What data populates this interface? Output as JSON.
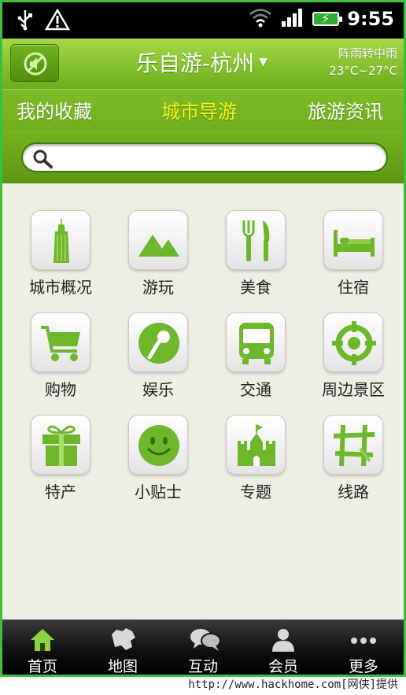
{
  "status_bar": {
    "time": "9:55"
  },
  "header": {
    "title": "乐自游-杭州",
    "weather_desc": "阵雨转中雨",
    "weather_temp": "23°C~27°C"
  },
  "tabs": [
    {
      "label": "我的收藏"
    },
    {
      "label": "城市导游",
      "active": true
    },
    {
      "label": "旅游资讯"
    }
  ],
  "search": {
    "value": "",
    "placeholder": ""
  },
  "grid": [
    {
      "label": "城市概况",
      "icon": "building-icon"
    },
    {
      "label": "游玩",
      "icon": "mountain-icon"
    },
    {
      "label": "美食",
      "icon": "fork-knife-icon"
    },
    {
      "label": "住宿",
      "icon": "bed-icon"
    },
    {
      "label": "购物",
      "icon": "cart-icon"
    },
    {
      "label": "娱乐",
      "icon": "microphone-icon"
    },
    {
      "label": "交通",
      "icon": "bus-icon"
    },
    {
      "label": "周边景区",
      "icon": "target-icon"
    },
    {
      "label": "特产",
      "icon": "gift-icon"
    },
    {
      "label": "小贴士",
      "icon": "smiley-icon"
    },
    {
      "label": "专题",
      "icon": "castle-icon"
    },
    {
      "label": "线路",
      "icon": "route-icon"
    }
  ],
  "bottom_nav": [
    {
      "label": "首页",
      "icon": "home-icon",
      "active": true
    },
    {
      "label": "地图",
      "icon": "map-icon"
    },
    {
      "label": "互动",
      "icon": "chat-icon"
    },
    {
      "label": "会员",
      "icon": "user-icon"
    },
    {
      "label": "更多",
      "icon": "more-icon"
    }
  ],
  "watermark": "http://www.hackhome.com[网侠]提供",
  "colors": {
    "accent": "#7cbc26",
    "active_tab": "#f4f41a",
    "icon_green": "#6cb82a"
  }
}
